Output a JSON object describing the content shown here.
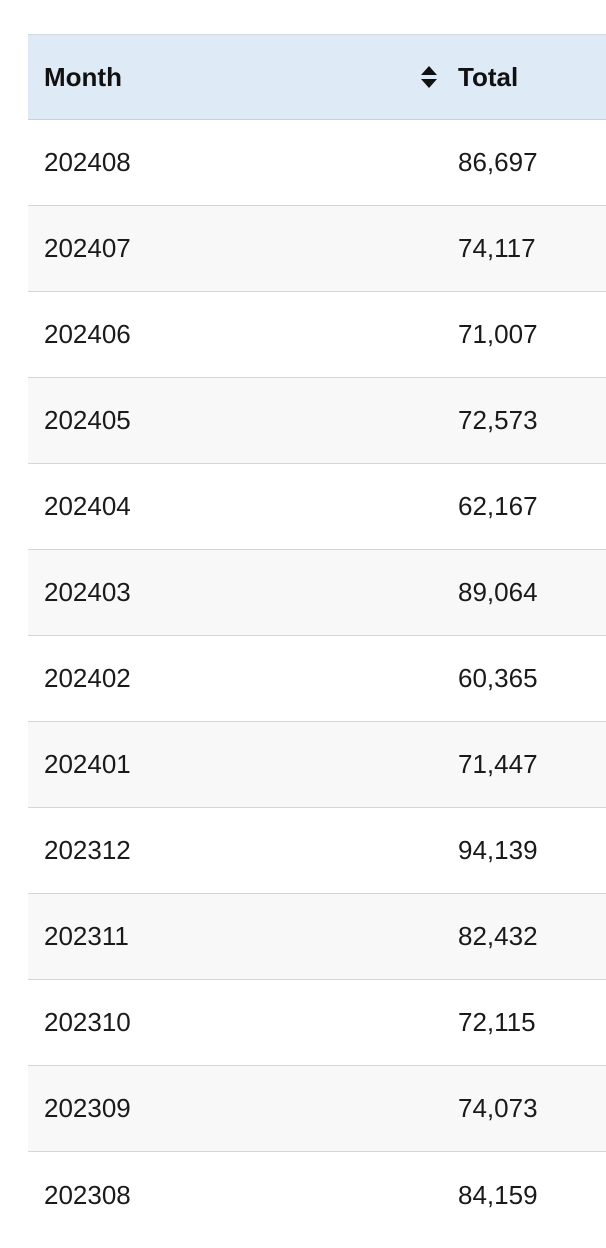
{
  "table": {
    "headers": {
      "month": "Month",
      "total": "Total"
    },
    "sort_icon": "sort-updown-icon",
    "rows": [
      {
        "month": "202408",
        "total": "86,697"
      },
      {
        "month": "202407",
        "total": "74,117"
      },
      {
        "month": "202406",
        "total": "71,007"
      },
      {
        "month": "202405",
        "total": "72,573"
      },
      {
        "month": "202404",
        "total": "62,167"
      },
      {
        "month": "202403",
        "total": "89,064"
      },
      {
        "month": "202402",
        "total": "60,365"
      },
      {
        "month": "202401",
        "total": "71,447"
      },
      {
        "month": "202312",
        "total": "94,139"
      },
      {
        "month": "202311",
        "total": "82,432"
      },
      {
        "month": "202310",
        "total": "72,115"
      },
      {
        "month": "202309",
        "total": "74,073"
      },
      {
        "month": "202308",
        "total": "84,159"
      }
    ]
  },
  "colors": {
    "header_bg": "#deebf7",
    "stripe_bg": "#f8f8f8",
    "border": "#d6d6d6"
  }
}
